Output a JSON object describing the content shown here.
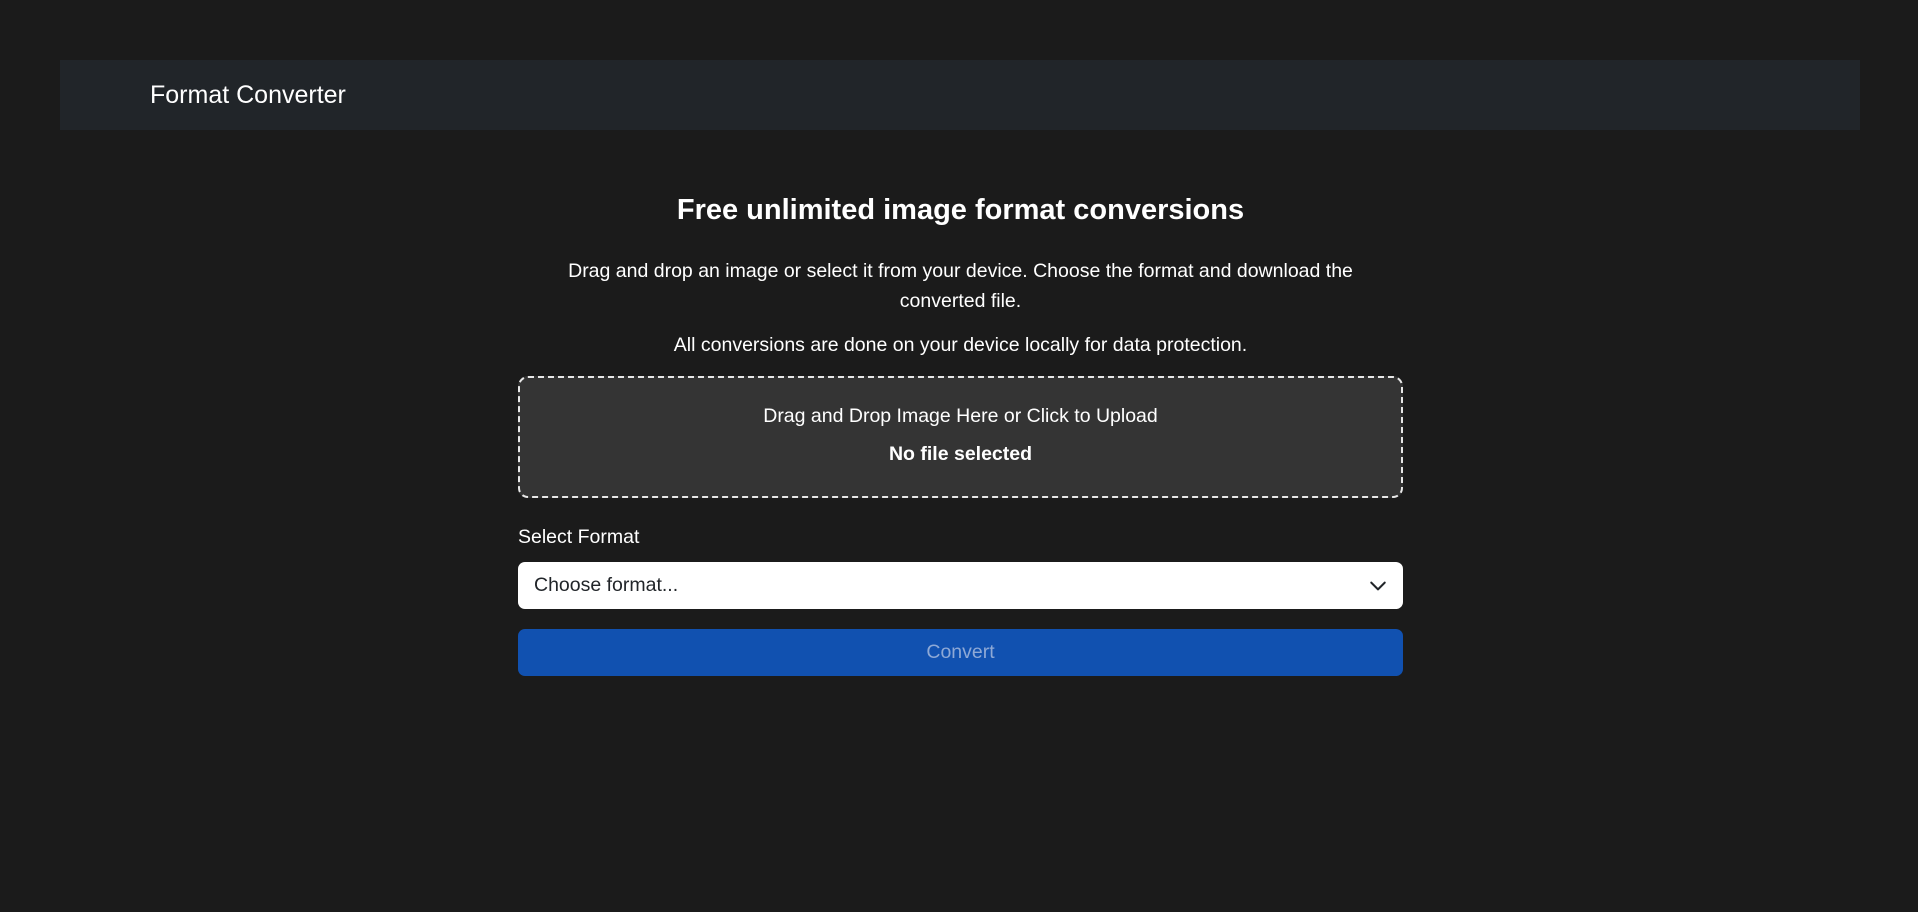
{
  "navbar": {
    "brand": "Format Converter"
  },
  "main": {
    "title": "Free unlimited image format conversions",
    "description": "Drag and drop an image or select it from your device. Choose the format and download the converted file.",
    "note": "All conversions are done on your device locally for data protection."
  },
  "dropzone": {
    "prompt": "Drag and Drop Image Here or Click to Upload",
    "file_status": "No file selected"
  },
  "format": {
    "label": "Select Format",
    "selected": "Choose format..."
  },
  "convert": {
    "label": "Convert",
    "disabled": true
  },
  "colors": {
    "background": "#1b1b1b",
    "navbar": "#212529",
    "dropzone": "#343434",
    "button": "#1151b0",
    "button_text": "#8ea9d6"
  },
  "icons": {
    "select_arrow": "chevron-down-icon"
  }
}
